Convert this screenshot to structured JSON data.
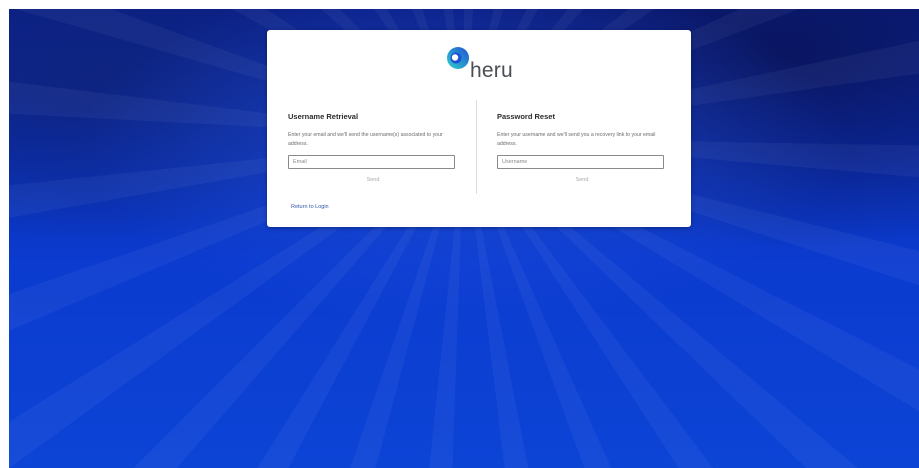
{
  "brand": {
    "name": "heru",
    "colors": {
      "mark_blue": "#1f4fd6",
      "mark_teal": "#2fd3c7",
      "text": "#4a4f55"
    },
    "icon": "heru-logo-mark-icon"
  },
  "username_retrieval": {
    "title": "Username Retrieval",
    "description": "Enter your email and we'll send the username(s) associated to your address.",
    "input_placeholder": "Email",
    "input_value": "",
    "send_label": "Send"
  },
  "password_reset": {
    "title": "Password Reset",
    "description": "Enter your username and we'll send you a recovery link to your email address.",
    "input_placeholder": "Username",
    "input_value": "",
    "send_label": "Send"
  },
  "footer": {
    "return_link_label": "Return to Login"
  },
  "colors": {
    "background_top": "#0a1f8a",
    "background_bottom": "#0c44d6",
    "link": "#2f57a8",
    "disabled_button_text": "#a9a9a9"
  }
}
